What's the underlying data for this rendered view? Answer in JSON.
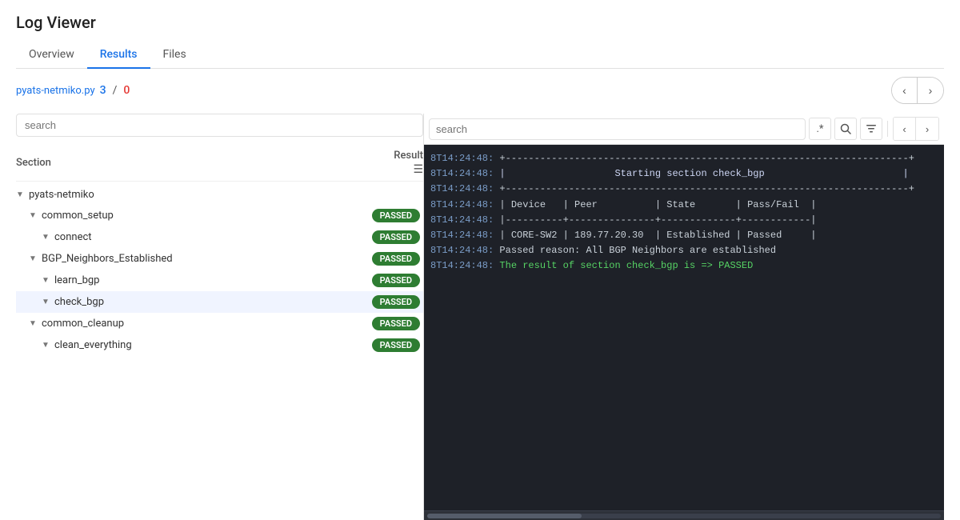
{
  "app": {
    "title": "Log Viewer"
  },
  "tabs": [
    {
      "id": "overview",
      "label": "Overview",
      "active": false
    },
    {
      "id": "results",
      "label": "Results",
      "active": true
    },
    {
      "id": "files",
      "label": "Files",
      "active": false
    }
  ],
  "filebar": {
    "filename": "pyats-netmiko.py",
    "pass_count": "3",
    "separator": "/",
    "fail_count": "0"
  },
  "nav": {
    "prev_label": "<",
    "next_label": ">"
  },
  "left_panel": {
    "search_placeholder": "search",
    "section_header": "Section",
    "result_header": "Result",
    "filter_icon": "≡",
    "tree": [
      {
        "id": "pyats-netmiko",
        "name": "pyats-netmiko",
        "indent": 1,
        "chevron": "▼",
        "badge": null,
        "selected": false
      },
      {
        "id": "common_setup",
        "name": "common_setup",
        "indent": 2,
        "chevron": "▼",
        "badge": "PASSED",
        "selected": false
      },
      {
        "id": "connect",
        "name": "connect",
        "indent": 3,
        "chevron": "▼",
        "badge": "PASSED",
        "selected": false
      },
      {
        "id": "BGP_Neighbors_Established",
        "name": "BGP_Neighbors_Established",
        "indent": 2,
        "chevron": "▼",
        "badge": "PASSED",
        "selected": false
      },
      {
        "id": "learn_bgp",
        "name": "learn_bgp",
        "indent": 3,
        "chevron": "▼",
        "badge": "PASSED",
        "selected": false
      },
      {
        "id": "check_bgp",
        "name": "check_bgp",
        "indent": 3,
        "chevron": "▼",
        "badge": "PASSED",
        "selected": true
      },
      {
        "id": "common_cleanup",
        "name": "common_cleanup",
        "indent": 2,
        "chevron": "▼",
        "badge": "PASSED",
        "selected": false
      },
      {
        "id": "clean_everything",
        "name": "clean_everything",
        "indent": 3,
        "chevron": "▼",
        "badge": "PASSED",
        "selected": false
      }
    ]
  },
  "right_panel": {
    "search_placeholder": "search",
    "regex_btn": ".*",
    "search_icon": "🔍",
    "filter_btn": "⊞",
    "nav_prev": "<",
    "nav_next": ">",
    "log_lines": [
      {
        "time": "8T14:24:48:",
        "text": "+-----------------------------------------------------------------------+"
      },
      {
        "time": "8T14:24:48:",
        "text": "|                   Starting section check_bgp                         |"
      },
      {
        "time": "8T14:24:48:",
        "text": "+-----------------------------------------------------------------------+"
      },
      {
        "time": "8T14:24:48:",
        "text": "| Device   | Peer          | State       | Pass/Fail  |"
      },
      {
        "time": "8T14:24:48:",
        "text": "|----------+---------------+-------------+------------|"
      },
      {
        "time": "8T14:24:48:",
        "text": "| CORE-SW2 | 189.77.20.30  | Established | Passed     |"
      },
      {
        "time": "8T14:24:48:",
        "text": "Passed reason: All BGP Neighbors are established"
      },
      {
        "time": "8T14:24:48:",
        "text": "The result of section check_bgp is => PASSED"
      }
    ]
  }
}
